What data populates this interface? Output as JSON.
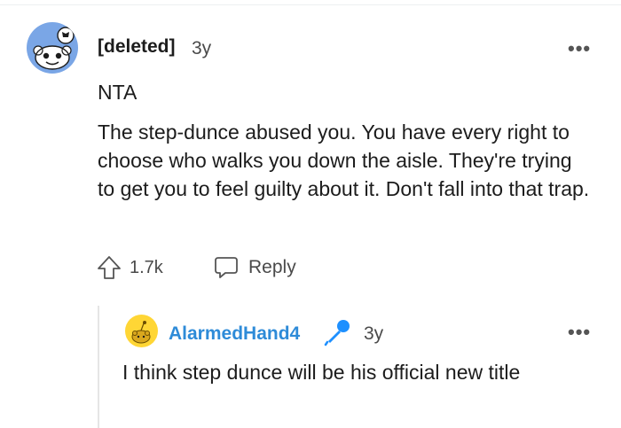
{
  "comment": {
    "author": "[deleted]",
    "age": "3y",
    "lines": [
      "NTA",
      "The step-dunce abused you. You have every right to choose who walks you down the aisle. They're trying to get you to feel guilty about it. Don't fall into that trap."
    ],
    "upvotes": "1.7k",
    "reply_label": "Reply",
    "more_label": "•••"
  },
  "reply": {
    "author": "AlarmedHand4",
    "age": "3y",
    "text": "I think step dunce will be his official new title",
    "more_label": "•••",
    "flair_icon": "microphone-icon"
  },
  "colors": {
    "username_blue": "#2e8bd8",
    "avatar_blue": "#7aa6e6",
    "avatar_yellow": "#ffd635",
    "mic_blue": "#1e90ff"
  }
}
